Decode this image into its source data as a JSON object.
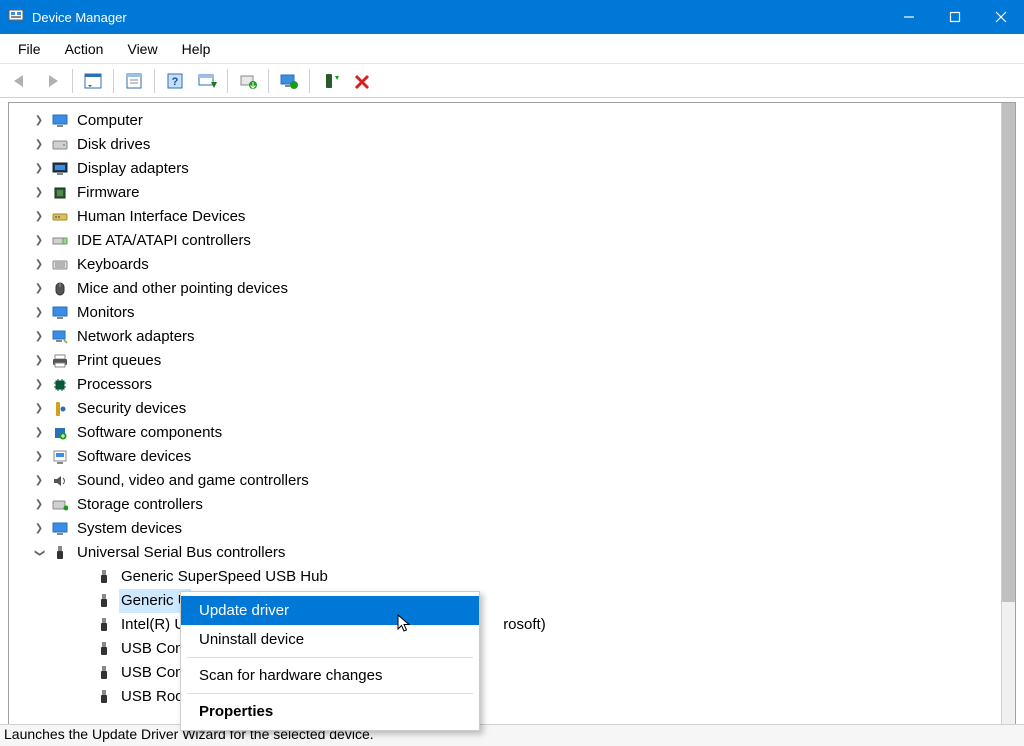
{
  "window_title": "Device Manager",
  "menu": [
    "File",
    "Action",
    "View",
    "Help"
  ],
  "tree": {
    "top": [
      "Computer",
      "Disk drives",
      "Display adapters",
      "Firmware",
      "Human Interface Devices",
      "IDE ATA/ATAPI controllers",
      "Keyboards",
      "Mice and other pointing devices",
      "Monitors",
      "Network adapters",
      "Print queues",
      "Processors",
      "Security devices",
      "Software components",
      "Software devices",
      "Sound, video and game controllers",
      "Storage controllers",
      "System devices"
    ],
    "usb_parent": "Universal Serial Bus controllers",
    "usb_children": [
      "Generic SuperSpeed USB Hub",
      "Generic U",
      "Intel(R) U",
      "USB Com",
      "USB Com",
      "USB Roo"
    ],
    "usb_children_suffix": [
      "",
      "",
      "rosoft)",
      "",
      "",
      ""
    ]
  },
  "top_icons": [
    "computer-icon",
    "disk-icon",
    "display-icon",
    "firmware-icon",
    "hid-icon",
    "ide-icon",
    "keyboard-icon",
    "mouse-icon",
    "monitor-icon",
    "network-icon",
    "printer-icon",
    "processor-icon",
    "security-icon",
    "softcomp-icon",
    "swdev-icon",
    "sound-icon",
    "storage-icon",
    "sysdev-icon"
  ],
  "context_menu": {
    "update": "Update driver",
    "uninstall": "Uninstall device",
    "scan": "Scan for hardware changes",
    "properties": "Properties"
  },
  "status_text": "Launches the Update Driver Wizard for the selected device."
}
